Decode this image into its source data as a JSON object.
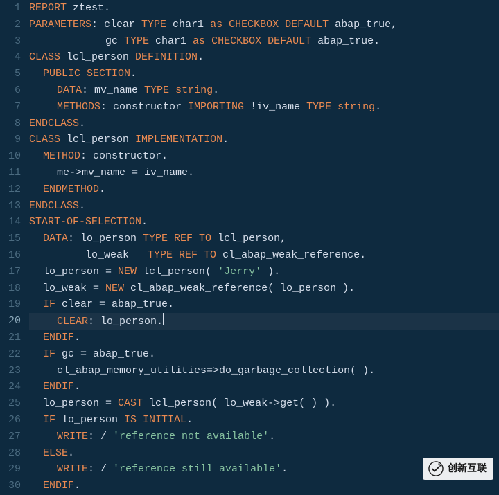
{
  "editor": {
    "current_line": 20,
    "lines": [
      {
        "n": 1,
        "indent": 0,
        "tokens": [
          [
            "kw",
            "REPORT"
          ],
          [
            "id",
            " ztest."
          ]
        ]
      },
      {
        "n": 2,
        "indent": 0,
        "tokens": [
          [
            "kw",
            "PARAMETERS"
          ],
          [
            "id",
            ": clear "
          ],
          [
            "kw",
            "TYPE"
          ],
          [
            "id",
            " char1 "
          ],
          [
            "kw",
            "as"
          ],
          [
            "id",
            " "
          ],
          [
            "kw",
            "CHECKBOX DEFAULT"
          ],
          [
            "id",
            " abap_true,"
          ]
        ]
      },
      {
        "n": 3,
        "indent": "x",
        "tokens": [
          [
            "id",
            "gc "
          ],
          [
            "kw",
            "TYPE"
          ],
          [
            "id",
            " char1 "
          ],
          [
            "kw",
            "as"
          ],
          [
            "id",
            " "
          ],
          [
            "kw",
            "CHECKBOX DEFAULT"
          ],
          [
            "id",
            " abap_true."
          ]
        ]
      },
      {
        "n": 4,
        "indent": 0,
        "tokens": [
          [
            "kw",
            "CLASS"
          ],
          [
            "id",
            " lcl_person "
          ],
          [
            "kw",
            "DEFINITION"
          ],
          [
            "id",
            "."
          ]
        ]
      },
      {
        "n": 5,
        "indent": 1,
        "tokens": [
          [
            "kw",
            "PUBLIC SECTION"
          ],
          [
            "id",
            "."
          ]
        ]
      },
      {
        "n": 6,
        "indent": 2,
        "tokens": [
          [
            "kw",
            "DATA"
          ],
          [
            "id",
            ": mv_name "
          ],
          [
            "kw",
            "TYPE"
          ],
          [
            "id",
            " "
          ],
          [
            "kw",
            "string"
          ],
          [
            "id",
            "."
          ]
        ]
      },
      {
        "n": 7,
        "indent": 2,
        "tokens": [
          [
            "kw",
            "METHODS"
          ],
          [
            "id",
            ": constructor "
          ],
          [
            "kw",
            "IMPORTING"
          ],
          [
            "id",
            " !iv_name "
          ],
          [
            "kw",
            "TYPE"
          ],
          [
            "id",
            " "
          ],
          [
            "kw",
            "string"
          ],
          [
            "id",
            "."
          ]
        ]
      },
      {
        "n": 8,
        "indent": 0,
        "tokens": [
          [
            "kw",
            "ENDCLASS"
          ],
          [
            "id",
            "."
          ]
        ]
      },
      {
        "n": 9,
        "indent": 0,
        "tokens": [
          [
            "kw",
            "CLASS"
          ],
          [
            "id",
            " lcl_person "
          ],
          [
            "kw",
            "IMPLEMENTATION"
          ],
          [
            "id",
            "."
          ]
        ]
      },
      {
        "n": 10,
        "indent": 1,
        "tokens": [
          [
            "kw",
            "METHOD"
          ],
          [
            "id",
            ": constructor."
          ]
        ]
      },
      {
        "n": 11,
        "indent": 2,
        "tokens": [
          [
            "id",
            "me->mv_name = iv_name."
          ]
        ]
      },
      {
        "n": 12,
        "indent": 1,
        "tokens": [
          [
            "kw",
            "ENDMETHOD"
          ],
          [
            "id",
            "."
          ]
        ]
      },
      {
        "n": 13,
        "indent": 0,
        "tokens": [
          [
            "kw",
            "ENDCLASS"
          ],
          [
            "id",
            "."
          ]
        ]
      },
      {
        "n": 14,
        "indent": 0,
        "tokens": [
          [
            "kw",
            "START-OF-SELECTION"
          ],
          [
            "id",
            "."
          ]
        ]
      },
      {
        "n": 15,
        "indent": 1,
        "tokens": [
          [
            "kw",
            "DATA"
          ],
          [
            "id",
            ": lo_person "
          ],
          [
            "kw",
            "TYPE REF TO"
          ],
          [
            "id",
            " lcl_person,"
          ]
        ]
      },
      {
        "n": 16,
        "indent": 0,
        "raw": "         lo_weak   ",
        "tokens": [
          [
            "kw",
            "TYPE REF TO"
          ],
          [
            "id",
            " cl_abap_weak_reference."
          ]
        ]
      },
      {
        "n": 17,
        "indent": 1,
        "tokens": [
          [
            "id",
            "lo_person = "
          ],
          [
            "kw",
            "NEW"
          ],
          [
            "id",
            " lcl_person( "
          ],
          [
            "str",
            "'Jerry'"
          ],
          [
            "id",
            " )."
          ]
        ]
      },
      {
        "n": 18,
        "indent": 1,
        "tokens": [
          [
            "id",
            "lo_weak = "
          ],
          [
            "kw",
            "NEW"
          ],
          [
            "id",
            " cl_abap_weak_reference( lo_person )."
          ]
        ]
      },
      {
        "n": 19,
        "indent": 1,
        "tokens": [
          [
            "kw",
            "IF"
          ],
          [
            "id",
            " clear = abap_true."
          ]
        ]
      },
      {
        "n": 20,
        "indent": 2,
        "tokens": [
          [
            "kw",
            "CLEAR"
          ],
          [
            "id",
            ": lo_person."
          ]
        ],
        "cursor": true
      },
      {
        "n": 21,
        "indent": 1,
        "tokens": [
          [
            "kw",
            "ENDIF"
          ],
          [
            "id",
            "."
          ]
        ]
      },
      {
        "n": 22,
        "indent": 1,
        "tokens": [
          [
            "kw",
            "IF"
          ],
          [
            "id",
            " gc = abap_true."
          ]
        ]
      },
      {
        "n": 23,
        "indent": 2,
        "tokens": [
          [
            "id",
            "cl_abap_memory_utilities=>do_garbage_collection( )."
          ]
        ]
      },
      {
        "n": 24,
        "indent": 1,
        "tokens": [
          [
            "kw",
            "ENDIF"
          ],
          [
            "id",
            "."
          ]
        ]
      },
      {
        "n": 25,
        "indent": 1,
        "tokens": [
          [
            "id",
            "lo_person = "
          ],
          [
            "kw",
            "CAST"
          ],
          [
            "id",
            " lcl_person( lo_weak->get( ) )."
          ]
        ]
      },
      {
        "n": 26,
        "indent": 1,
        "tokens": [
          [
            "kw",
            "IF"
          ],
          [
            "id",
            " lo_person "
          ],
          [
            "kw",
            "IS INITIAL"
          ],
          [
            "id",
            "."
          ]
        ]
      },
      {
        "n": 27,
        "indent": 2,
        "tokens": [
          [
            "kw",
            "WRITE"
          ],
          [
            "id",
            ": / "
          ],
          [
            "str",
            "'reference not available'"
          ],
          [
            "id",
            "."
          ]
        ]
      },
      {
        "n": 28,
        "indent": 1,
        "tokens": [
          [
            "kw",
            "ELSE"
          ],
          [
            "id",
            "."
          ]
        ]
      },
      {
        "n": 29,
        "indent": 2,
        "tokens": [
          [
            "kw",
            "WRITE"
          ],
          [
            "id",
            ": / "
          ],
          [
            "str",
            "'reference still available'"
          ],
          [
            "id",
            "."
          ]
        ]
      },
      {
        "n": 30,
        "indent": 1,
        "tokens": [
          [
            "kw",
            "ENDIF"
          ],
          [
            "id",
            "."
          ]
        ]
      }
    ]
  },
  "watermark": {
    "text": "创新互联"
  }
}
